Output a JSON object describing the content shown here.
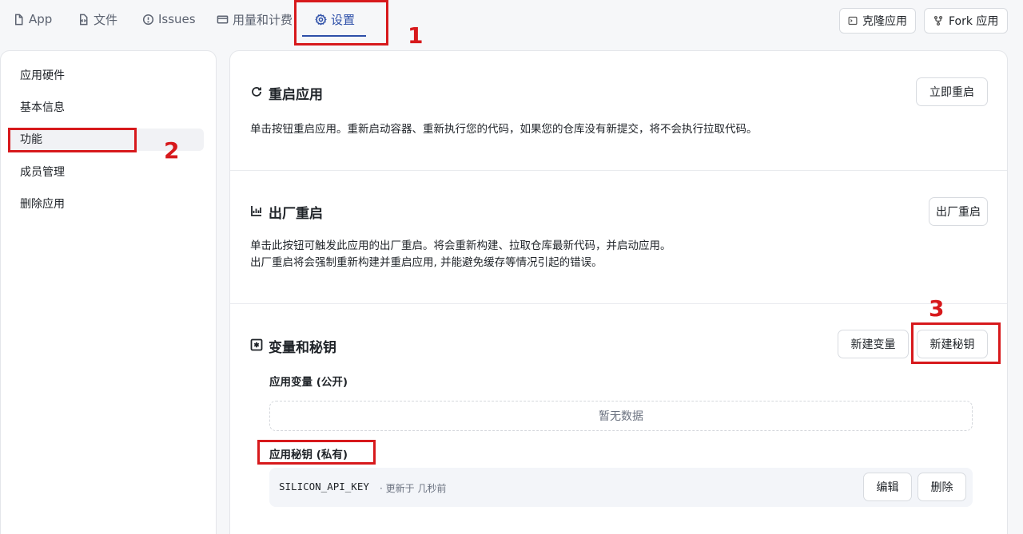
{
  "tabs": [
    {
      "label": "App",
      "icon": "file-icon"
    },
    {
      "label": "文件",
      "icon": "code-file-icon"
    },
    {
      "label": "Issues",
      "icon": "issue-icon"
    },
    {
      "label": "用量和计费",
      "icon": "card-icon"
    },
    {
      "label": "设置",
      "icon": "gear-icon",
      "active": true
    }
  ],
  "header_actions": {
    "clone": "克隆应用",
    "fork": "Fork 应用"
  },
  "sidebar": {
    "items": [
      {
        "label": "应用硬件"
      },
      {
        "label": "基本信息"
      },
      {
        "label": "功能",
        "active": true
      },
      {
        "label": "成员管理"
      },
      {
        "label": "删除应用"
      }
    ]
  },
  "sections": {
    "restart": {
      "title": "重启应用",
      "description": "单击按钮重启应用。重新启动容器、重新执行您的代码，如果您的仓库没有新提交，将不会执行拉取代码。",
      "button": "立即重启"
    },
    "factory": {
      "title": "出厂重启",
      "description_line1": "单击此按钮可触发此应用的出厂重启。将会重新构建、拉取仓库最新代码，并启动应用。",
      "description_line2": "出厂重启将会强制重新构建并重启应用, 并能避免缓存等情况引起的错误。",
      "button": "出厂重启"
    },
    "variables": {
      "title": "变量和秘钥",
      "new_var_button": "新建变量",
      "new_secret_button": "新建秘钥",
      "public_label": "应用变量 (公开)",
      "empty_text": "暂无数据",
      "private_label": "应用秘钥 (私有)",
      "secrets": [
        {
          "key": "SILICON_API_KEY",
          "meta": "· 更新于 几秒前",
          "edit": "编辑",
          "delete": "删除"
        }
      ]
    }
  },
  "annotations": {
    "one": "1",
    "two": "2",
    "three": "3",
    "color": "#d7191c"
  },
  "colors": {
    "accent": "#2d4fa8"
  }
}
